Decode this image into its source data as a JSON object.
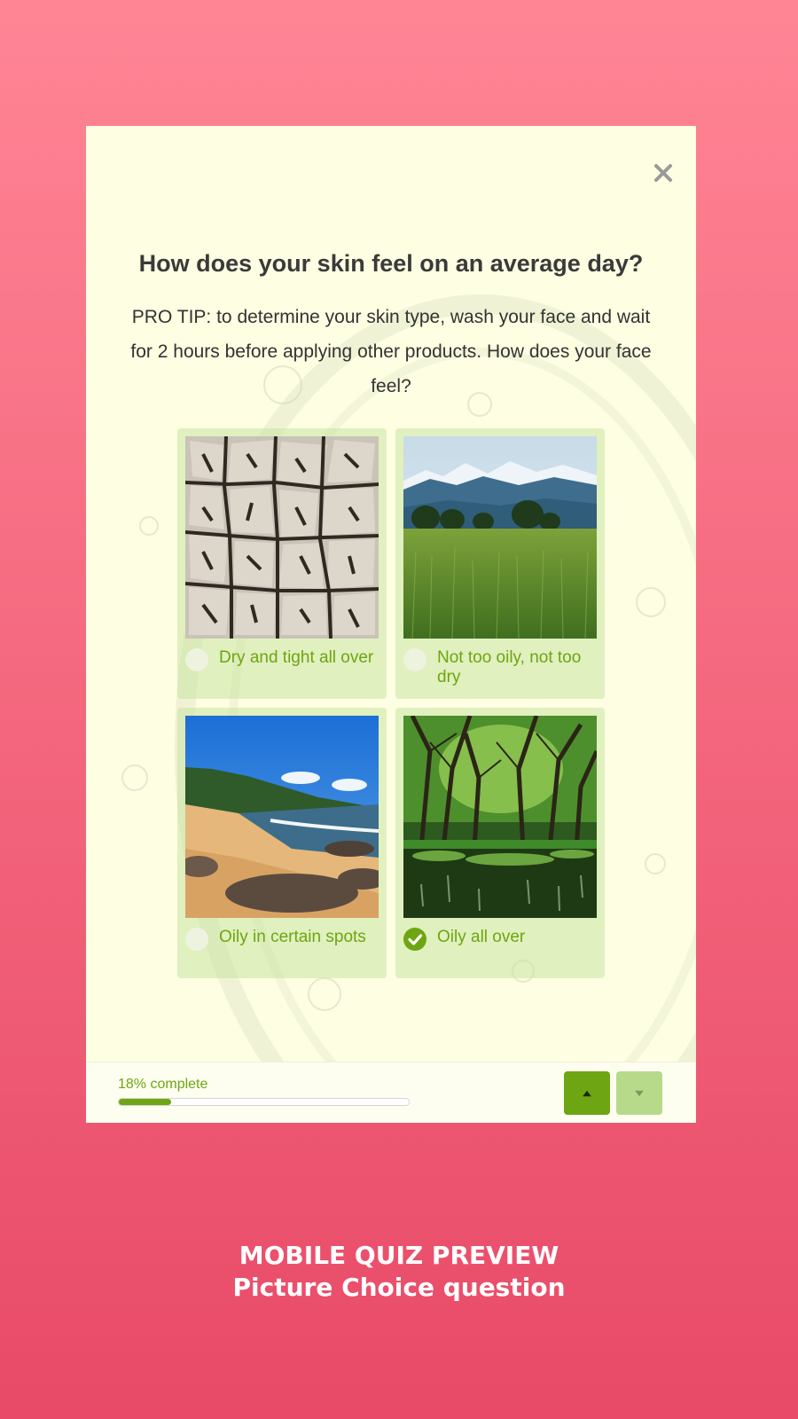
{
  "question": {
    "title": "How does your skin feel on an average day?",
    "subtitle": "PRO TIP: to determine your skin type, wash your face and wait for 2 hours before applying other products. How does your face feel?"
  },
  "options": [
    {
      "label": "Dry and tight all over",
      "image": "cracked-dry-earth",
      "selected": false
    },
    {
      "label": "Not too oily, not too dry",
      "image": "green-meadow-mountains",
      "selected": false
    },
    {
      "label": "Oily in certain spots",
      "image": "sandy-beach-rocks",
      "selected": false
    },
    {
      "label": "Oily all over",
      "image": "swamp-forest",
      "selected": true
    }
  ],
  "progress": {
    "label": "18% complete",
    "percent": 18
  },
  "navigation": {
    "up_icon": "caret-up-icon",
    "down_icon": "caret-down-icon"
  },
  "caption": {
    "line1": "MOBILE QUIZ PREVIEW",
    "line2": "Picture Choice question"
  },
  "colors": {
    "accent": "#6ea513",
    "accent_light": "#b7da8a",
    "card_bg": "#fdfee2",
    "page_bg_top": "#ff8595",
    "page_bg_bottom": "#e84a67"
  }
}
